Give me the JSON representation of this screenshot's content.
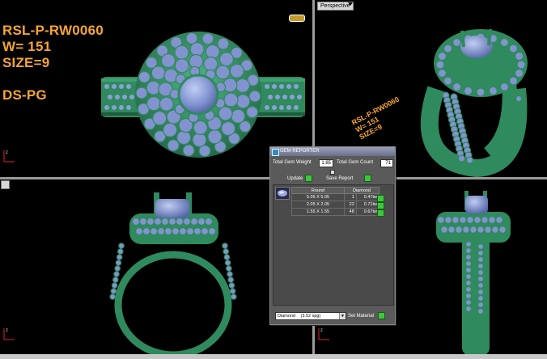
{
  "viewports": {
    "perspective_label": "Perspective"
  },
  "ring_info": {
    "line1": "RSL-P-RW0060",
    "line2": "W= 151",
    "line3": "SIZE=9",
    "line4": "DS-PG"
  },
  "engraving": {
    "line1": "RSL-P-RW0060",
    "line2": "W= 151",
    "line3": "SIZE=9"
  },
  "gem_reporter": {
    "title": "GEM REPORTER",
    "total_weight_label": "Total Gem Weight",
    "total_weight_value": "1.85",
    "total_count_label": "Total Gem Count",
    "total_count_value": "71",
    "update_label": "Update",
    "save_report_label": "Save Report",
    "table": {
      "shape_header": "Round",
      "material_header": "Diamond",
      "rows": [
        {
          "size": "5.05 X 5.05",
          "count": "1",
          "weight": "0.47tw"
        },
        {
          "size": "2.05 X 2.05",
          "count": "22",
          "weight": "0.71tw"
        },
        {
          "size": "1.55 X 1.55",
          "count": "48",
          "weight": "0.67tw"
        }
      ]
    },
    "material_select": "Diamond",
    "material_select_sg": "(3.52 spg)",
    "set_material_label": "Set Material"
  },
  "colors": {
    "metal": "#2f8a5e",
    "metal_dark": "#1d5c3d",
    "gem": "#7f92d0",
    "gem_light": "#a9b8e8",
    "text_orange": "#f7a531"
  }
}
